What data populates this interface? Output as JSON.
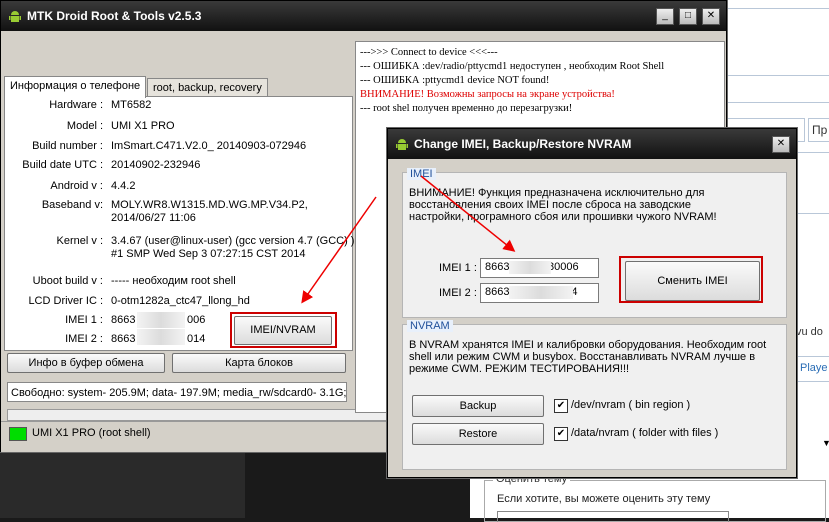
{
  "main": {
    "title": "MTK Droid Root & Tools v2.5.3",
    "tabs": [
      "Информация о телефоне",
      "root, backup, recovery"
    ],
    "info": {
      "labels": [
        "Hardware :",
        "Model :",
        "Build number :",
        "Build date UTC :",
        "Android  v :",
        "Baseband v:",
        "Kernel v :",
        "Uboot build v :",
        "LCD Driver IC :",
        "IMEI 1 :",
        "IMEI 2 :"
      ],
      "hardware": "MT6582",
      "model": "UMI X1 PRO",
      "build_number": "ImSmart.C471.V2.0_ 20140903-072946",
      "build_date": "20140902-232946",
      "android": "4.4.2",
      "baseband_1": "MOLY.WR8.W1315.MD.WG.MP.V34.P2,",
      "baseband_2": "2014/06/27 11:06",
      "kernel_1": "3.4.67 (user@linux-user) (gcc version 4.7 (GCC) )",
      "kernel_2": "#1 SMP  Wed Sep 3 07:27:15 CST 2014",
      "uboot": "----- необходим   root shell",
      "lcd": "0-otm1282a_ctc47_llong_hd",
      "imei1_start": "8663",
      "imei1_end": "006",
      "imei2_start": "8663",
      "imei2_end": "014"
    },
    "btn_imei_nvram": "IMEI/NVRAM",
    "btn_clipboard": "Инфо в буфер обмена",
    "btn_blocks": "Карта блоков",
    "free_space": "Свободно: system- 205.9M; data- 197.9M; media_rw/sdcard0- 3.1G;",
    "status": "UMI X1 PRO (root shell)",
    "status_color": "#00dd00",
    "log": [
      {
        "text": "--->>> Connect to device <<<---",
        "color": "#000000"
      },
      {
        "text": "--- ОШИБКА   :dev/radio/pttycmd1 недоступен  , необходим   Root Shell",
        "color": "#000000"
      },
      {
        "text": "--- ОШИБКА   :pttycmd1 device NOT found!",
        "color": "#000000"
      },
      {
        "text": "ВНИМАНИЕ! Возможны запросы на экране устройства!",
        "color": "#dd0000"
      },
      {
        "text": "--- root shel получен временно до перезагрузки!",
        "color": "#000000"
      }
    ]
  },
  "dialog": {
    "title": "Change IMEI, Backup/Restore NVRAM",
    "imei_group": "IMEI",
    "imei_warning": "ВНИМАНИЕ!  Функция предназначена исключительно для восстановления своих IMEI после сброса на заводские настройки, програмного сбоя  или прошивки чужого NVRAM!",
    "imei1_label": "IMEI 1 :",
    "imei2_label": "IMEI 2 :",
    "imei1_start": "8663",
    "imei1_end": "80006",
    "imei2_start": "8663",
    "imei2_end": "0014",
    "btn_change_imei": "Сменить IMEI",
    "nvram_group": "NVRAM",
    "nvram_text": "В NVRAM хранятся IMEI и калибровки оборудования. Необходим root shell или режим CWM и busybox. Восстанавливать NVRAM лучше в режиме CWM.  РЕЖИМ ТЕСТИРОВАНИЯ!!!",
    "btn_backup": "Backup",
    "btn_restore": "Restore",
    "chk1_label": "/dev/nvram  ( bin region )",
    "chk2_label": "/data/nvram  ( folder with files )"
  },
  "background": {
    "rate_title": "Оценить тему",
    "rate_text": "Если хотите, вы можете оценить эту тему",
    "right_frag_1": "Пр",
    "right_frag_2": "vu do",
    "right_frag_3": "Playe"
  }
}
